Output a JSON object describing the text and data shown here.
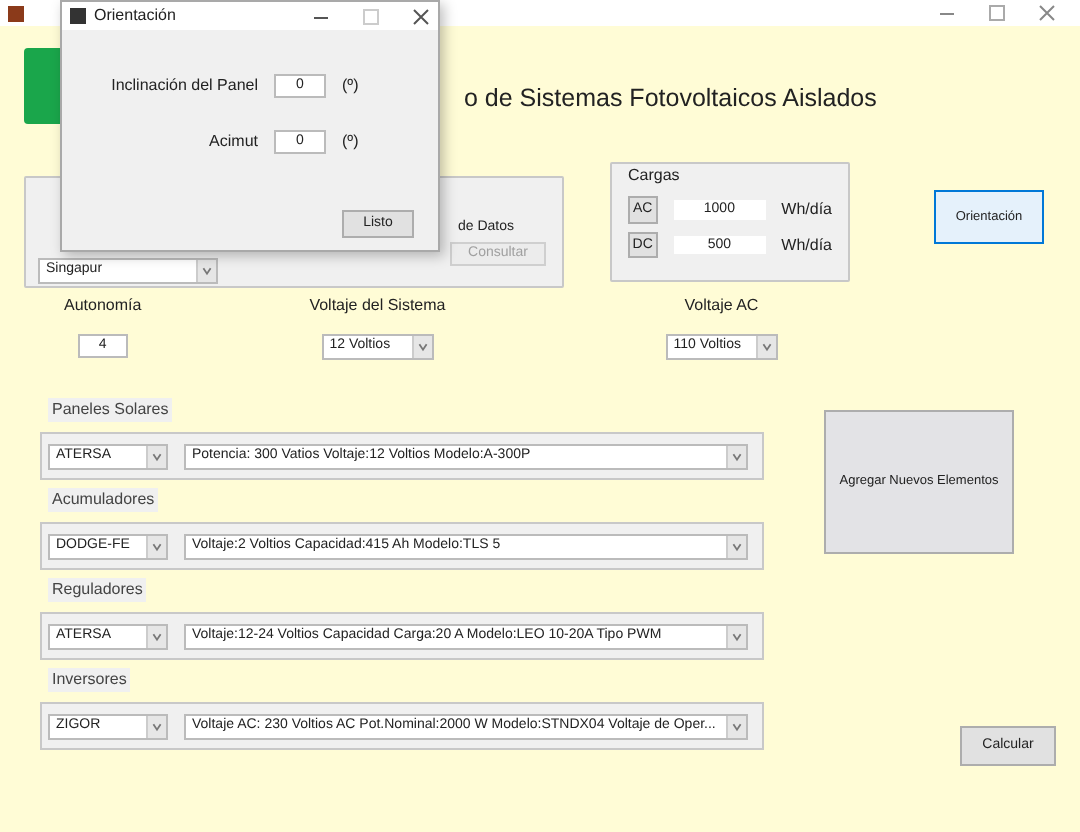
{
  "app_title": "o de Sistemas Fotovoltaicos Aislados",
  "location_panel": {
    "location": "Singapur",
    "database_label": "de Datos",
    "query_button": {
      "label": "Consultar",
      "disabled": true
    }
  },
  "loads": {
    "title": "Cargas",
    "rows": [
      {
        "button": "AC",
        "value": "1000",
        "unit": "Wh/día"
      },
      {
        "button": "DC",
        "value": "500",
        "unit": "Wh/día"
      }
    ]
  },
  "orientation_button": "Orientación",
  "settings": [
    {
      "label": "Autonomía",
      "kind": "input",
      "value": "4"
    },
    {
      "label": "Voltaje del Sistema",
      "kind": "select",
      "value": "12 Voltios"
    },
    {
      "label": "Voltaje AC",
      "kind": "select",
      "value": "110 Voltios"
    }
  ],
  "components": [
    {
      "title": "Paneles Solares",
      "brand": "ATERSA",
      "detail": "Potencia: 300 Vatios   Voltaje:12 Voltios   Modelo:A-300P"
    },
    {
      "title": "Acumuladores",
      "brand": "DODGE-FE",
      "detail": "Voltaje:2 Voltios   Capacidad:415 Ah   Modelo:TLS 5"
    },
    {
      "title": "Reguladores",
      "brand": "ATERSA",
      "detail": "Voltaje:12-24 Voltios   Capacidad Carga:20 A   Modelo:LEO 10-20A Tipo PWM"
    },
    {
      "title": "Inversores",
      "brand": "ZIGOR",
      "detail": "Voltaje AC: 230 Voltios AC   Pot.Nominal:2000 W   Modelo:STNDX04 Voltaje de Oper..."
    }
  ],
  "add_button": "Agregar Nuevos Elementos",
  "calculate_button": "Calcular",
  "dialog": {
    "title": "Orientación",
    "fields": [
      {
        "label": "Inclinación del Panel",
        "value": "0",
        "unit": "(º)"
      },
      {
        "label": "Acimut",
        "value": "0",
        "unit": "(º)"
      }
    ],
    "ok_button": "Listo"
  }
}
